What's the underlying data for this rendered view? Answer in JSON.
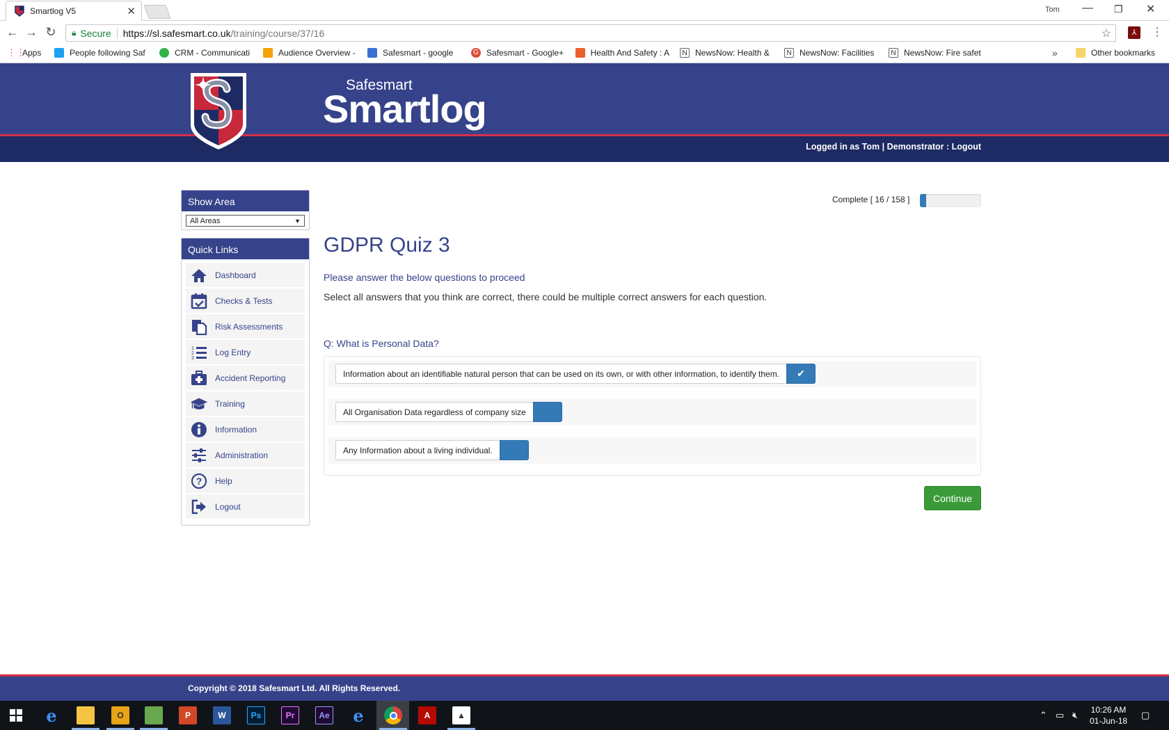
{
  "browser": {
    "tab_title": "Smartlog V5",
    "user": "Tom",
    "secure_label": "Secure",
    "url_host": "https://sl.safesmart.co.uk",
    "url_path": "/training/course/37/16",
    "bookmarks": [
      {
        "label": "Apps",
        "color": "#e04a3a"
      },
      {
        "label": "People following Saf",
        "color": "#1da1f2"
      },
      {
        "label": "CRM - Communicati",
        "color": "#2fb44a"
      },
      {
        "label": "Audience Overview -",
        "color": "#f4a400"
      },
      {
        "label": "Safesmart - google",
        "color": "#3b6fd6"
      },
      {
        "label": "Safesmart - Google+",
        "color": "#dd4b39"
      },
      {
        "label": "Health And Safety : A",
        "color": "#e8612c"
      },
      {
        "label": "NewsNow: Health &",
        "color": "#666666"
      },
      {
        "label": "NewsNow: Facilities",
        "color": "#666666"
      },
      {
        "label": "NewsNow: Fire safet",
        "color": "#666666"
      }
    ],
    "other_bookmarks": "Other bookmarks"
  },
  "header": {
    "brand_small": "Safesmart",
    "brand_big": "Smartlog",
    "logged_in_text": "Logged in as Tom | Demonstrator : ",
    "logout_link": "Logout"
  },
  "sidebar": {
    "show_area_title": "Show Area",
    "area_selected": "All Areas",
    "quick_links_title": "Quick Links",
    "items": [
      {
        "label": "Dashboard",
        "icon": "home-icon"
      },
      {
        "label": "Checks & Tests",
        "icon": "calendar-check-icon"
      },
      {
        "label": "Risk Assessments",
        "icon": "documents-icon"
      },
      {
        "label": "Log Entry",
        "icon": "numbered-list-icon"
      },
      {
        "label": "Accident Reporting",
        "icon": "first-aid-icon"
      },
      {
        "label": "Training",
        "icon": "graduation-cap-icon"
      },
      {
        "label": "Information",
        "icon": "info-icon"
      },
      {
        "label": "Administration",
        "icon": "sliders-icon"
      },
      {
        "label": "Help",
        "icon": "help-icon"
      },
      {
        "label": "Logout",
        "icon": "logout-icon"
      }
    ]
  },
  "main": {
    "progress_label": "Complete [ 16 / 158 ]",
    "progress_fraction": 0.101,
    "quiz_title": "GDPR Quiz 3",
    "intro_line1": "Please answer the below questions to proceed",
    "intro_line2": "Select all answers that you think are correct, there could be multiple correct answers for each question.",
    "question": "Q: What is Personal Data?",
    "answers": [
      {
        "text": "Information about an identifiable natural person that can be used on its own, or with other information, to identify them.",
        "checked": true
      },
      {
        "text": "All Organisation Data regardless of company size",
        "checked": false
      },
      {
        "text": "Any Information about a living individual.",
        "checked": false
      }
    ],
    "continue_label": "Continue"
  },
  "footer": {
    "copyright": "Copyright © 2018 Safesmart Ltd. All Rights Reserved."
  },
  "taskbar": {
    "time": "10:26 AM",
    "date": "01-Jun-18"
  },
  "colors": {
    "brand_blue": "#36438a",
    "brand_dark": "#1d2a63",
    "brand_red": "#d5304a",
    "check_blue": "#337ab7",
    "continue_green": "#3a9a3a"
  }
}
